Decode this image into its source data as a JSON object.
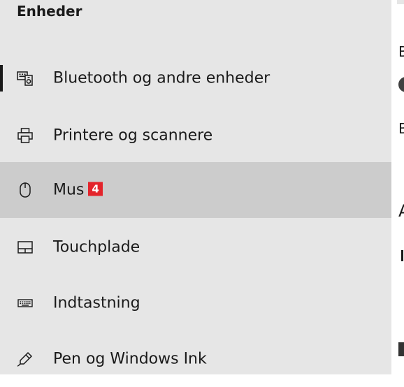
{
  "sidebar": {
    "section_title": "Enheder",
    "items": [
      {
        "label": "Bluetooth og andre enheder",
        "icon": "bluetooth-devices-icon",
        "active": true
      },
      {
        "label": "Printere og scannere",
        "icon": "printer-icon"
      },
      {
        "label": "Mus",
        "icon": "mouse-icon",
        "selected": true,
        "badge": "4"
      },
      {
        "label": "Touchplade",
        "icon": "touchpad-icon"
      },
      {
        "label": "Indtastning",
        "icon": "keyboard-icon"
      },
      {
        "label": "Pen og Windows Ink",
        "icon": "pen-icon"
      }
    ]
  },
  "right_pane": {
    "texts": [
      "B",
      "B",
      "A"
    ]
  },
  "colors": {
    "sidebar_bg": "#e6e6e6",
    "selected_bg": "#cccccc",
    "badge_bg": "#e3242b"
  }
}
